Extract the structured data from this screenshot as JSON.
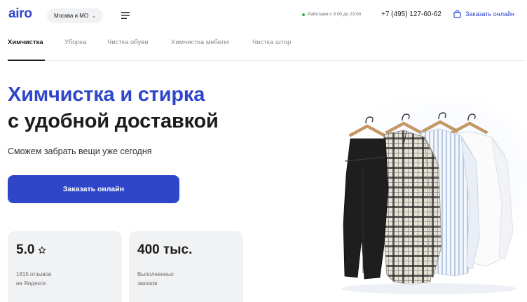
{
  "header": {
    "logo": "airo",
    "region": "Москва и МО",
    "hours": "Работаем с 9:00 до 23:00",
    "phone": "+7 (495) 127-60-62",
    "order_label": "Заказать онлайн"
  },
  "tabs": [
    {
      "label": "Химчистка",
      "active": true
    },
    {
      "label": "Уборка",
      "active": false
    },
    {
      "label": "Чистка обуви",
      "active": false
    },
    {
      "label": "Химчистка мебели",
      "active": false
    },
    {
      "label": "Чистка штор",
      "active": false
    }
  ],
  "hero": {
    "title_line1": "Химчистка и стирка",
    "title_line2": "с удобной доставкой",
    "subtitle": "Сможем забрать вещи уже сегодня",
    "cta_label": "Заказать онлайн"
  },
  "stats": [
    {
      "value": "5.0",
      "caption_line1": "1615 отзывов",
      "caption_line2": "на Яндексе",
      "icon": "star-outline-icon"
    },
    {
      "value": "400 тыс.",
      "caption_line1": "Выполненных",
      "caption_line2": "заказов"
    }
  ],
  "colors": {
    "brand": "#2f46c9",
    "status_green": "#2db34a",
    "card_bg": "#f1f2f4",
    "text": "#1c1c1c"
  }
}
